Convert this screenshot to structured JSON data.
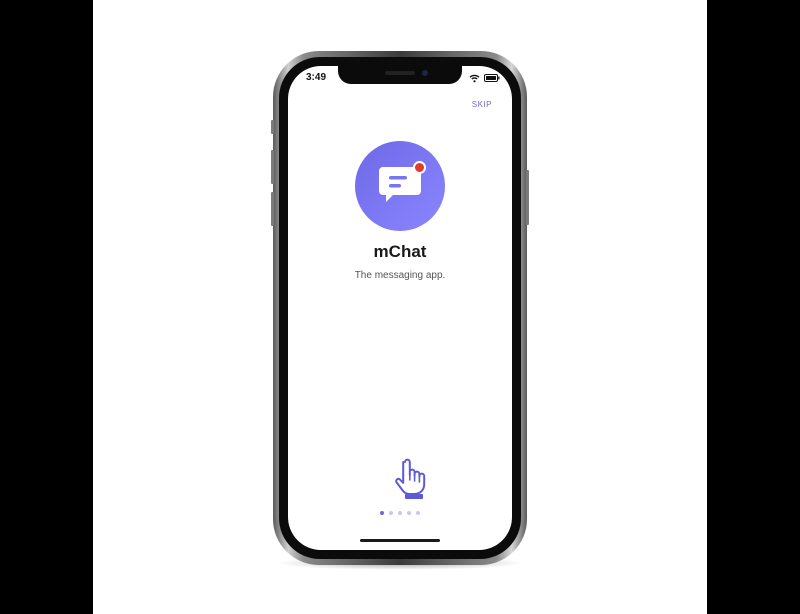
{
  "status_bar": {
    "time": "3:49"
  },
  "onboarding": {
    "skip_label": "SKIP",
    "app_name": "mChat",
    "tagline": "The messaging app.",
    "page_count": 5,
    "current_page": 1
  },
  "icons": {
    "app_logo": "chat-bubble-icon",
    "notification": "notification-dot-icon",
    "gesture": "pointing-hand-icon",
    "wifi": "wifi-icon",
    "battery": "battery-icon"
  },
  "colors": {
    "accent": "#6e6ad9",
    "logo_gradient_start": "#6e68e6",
    "logo_gradient_end": "#8a86ff",
    "notification": "#e43a2b",
    "dot_inactive": "#c9c7f3"
  }
}
